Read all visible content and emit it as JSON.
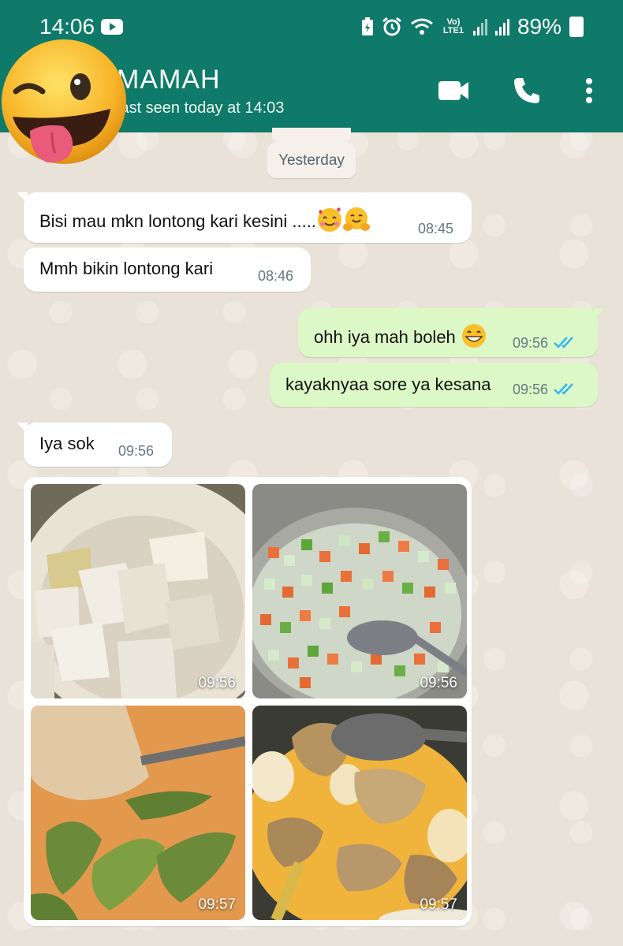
{
  "status_bar": {
    "time": "14:06",
    "network": "Vo) LTE1",
    "battery": "89%",
    "icons": [
      "youtube-icon",
      "battery-saver-icon",
      "alarm-icon",
      "wifi-icon",
      "signal-icon",
      "signal-icon",
      "battery-icon"
    ]
  },
  "header": {
    "name": "MAMAH",
    "status": "last seen today at 14:03",
    "icons": [
      "video-call-icon",
      "phone-call-icon",
      "more-options-icon"
    ],
    "color": "#0f7a69"
  },
  "date_chip": "Yesterday",
  "messages": [
    {
      "dir": "in",
      "text": "Bisi mau mkn lontong kari kesini .....",
      "emoji": [
        "smiling-face-with-hearts",
        "hugging-face"
      ],
      "time": "08:45"
    },
    {
      "dir": "in",
      "text": "Mmh bikin lontong kari",
      "time": "08:46"
    },
    {
      "dir": "out",
      "text": "ohh iya mah boleh",
      "emoji": [
        "grinning-face"
      ],
      "time": "09:56",
      "status": "read"
    },
    {
      "dir": "out",
      "text": "kayaknyaa sore ya kesana",
      "time": "09:56",
      "status": "read"
    },
    {
      "dir": "in",
      "text": "Iya sok",
      "time": "09:56"
    }
  ],
  "album": {
    "photos": [
      {
        "subject": "lontong-rice-cake-cubes",
        "time": "09:56"
      },
      {
        "subject": "diced-vegetables-in-pot",
        "time": "09:56"
      },
      {
        "subject": "vegetable-curry-with-spatula",
        "time": "09:57"
      },
      {
        "subject": "chicken-egg-curry-with-ladle",
        "time": "09:57"
      }
    ]
  },
  "colors": {
    "outgoing_bubble": "#dcf8c6",
    "incoming_bubble": "#ffffff",
    "read_ticks": "#34b7f1"
  }
}
